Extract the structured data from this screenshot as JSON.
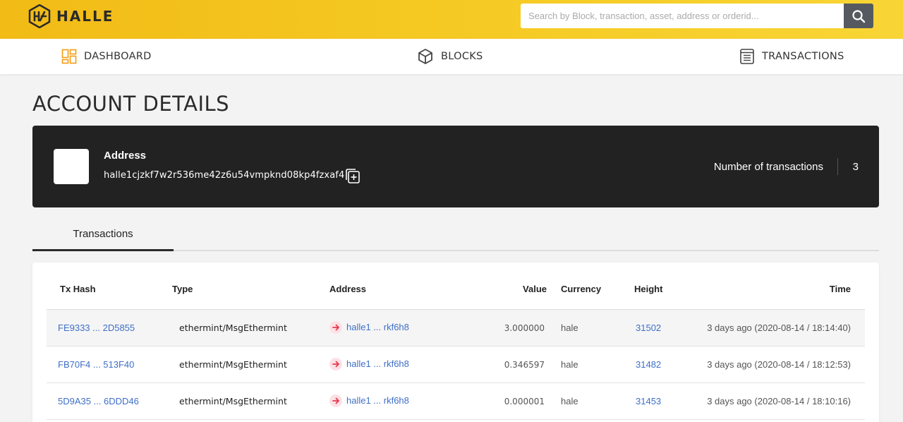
{
  "brand": {
    "name": "HALLE",
    "colors": {
      "header": "#f5c923",
      "dark_card": "#222222",
      "link": "#3f6fc7",
      "accent_orange": "#f39c12",
      "out_arrow": "#e63950"
    }
  },
  "search": {
    "placeholder": "Search by Block, transaction, asset, address or orderid...",
    "icon": "search-icon"
  },
  "nav": {
    "dashboard": {
      "label": "DASHBOARD",
      "icon": "dashboard-icon"
    },
    "blocks": {
      "label": "BLOCKS",
      "icon": "cube-icon"
    },
    "transactions": {
      "label": "TRANSACTIONS",
      "icon": "document-list-icon"
    }
  },
  "page": {
    "title": "ACCOUNT DETAILS"
  },
  "account": {
    "address_label": "Address",
    "address": "halle1cjzkf7w2r536me42z6u54vmpknd08kp4fzxaf4",
    "tx_count_label": "Number of transactions",
    "tx_count": "3"
  },
  "tabs": [
    {
      "label": "Transactions",
      "active": true
    }
  ],
  "table": {
    "headers": {
      "hash": "Tx Hash",
      "type": "Type",
      "address": "Address",
      "value": "Value",
      "currency": "Currency",
      "height": "Height",
      "time": "Time"
    },
    "rows": [
      {
        "hash": "FE9333 ... 2D5855",
        "type": "ethermint/MsgEthermint",
        "direction": "out",
        "address": "halle1 ... rkf6h8",
        "value": "3.000000",
        "currency": "hale",
        "height": "31502",
        "time": "3 days ago (2020-08-14 / 18:14:40)"
      },
      {
        "hash": "FB70F4 ... 513F40",
        "type": "ethermint/MsgEthermint",
        "direction": "out",
        "address": "halle1 ... rkf6h8",
        "value": "0.346597",
        "currency": "hale",
        "height": "31482",
        "time": "3 days ago (2020-08-14 / 18:12:53)"
      },
      {
        "hash": "5D9A35 ... 6DDD46",
        "type": "ethermint/MsgEthermint",
        "direction": "out",
        "address": "halle1 ... rkf6h8",
        "value": "0.000001",
        "currency": "hale",
        "height": "31453",
        "time": "3 days ago (2020-08-14 / 18:10:16)"
      }
    ]
  }
}
